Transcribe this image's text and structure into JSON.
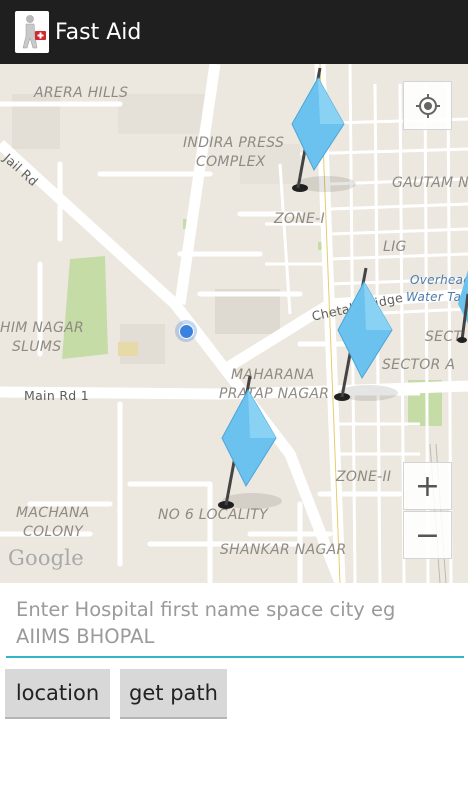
{
  "app": {
    "title": "Fast Aid",
    "icon": "first-aid-person-icon"
  },
  "map": {
    "labels": {
      "arera_hills": "ARERA HILLS",
      "indira_press_1": "INDIRA PRESS",
      "indira_press_2": "COMPLEX",
      "gautam_nagar": "GAUTAM NA",
      "jail_rd": "Jail Rd",
      "zone_1": "ZONE-I",
      "lig": "LIG",
      "overhead_1": "Overhead",
      "overhead_2": "Water Tank",
      "chetak_bridge": "Chetak Bridge",
      "sect": "SECT",
      "him_nagar_1": "HIM NAGAR",
      "him_nagar_2": "SLUMS",
      "sector_a": "SECTOR A",
      "maharana_1": "MAHARANA",
      "maharana_2": "PRATAP NAGAR",
      "main_rd": "Main Rd 1",
      "zone_2": "ZONE-II",
      "machana_1": "MACHANA",
      "machana_2": "COLONY",
      "no6": "NO 6 LOCALITY",
      "shankar_nagar": "SHANKAR NAGAR"
    },
    "google_logo": "Google",
    "controls": {
      "my_location_icon": "crosshair-icon",
      "zoom_in": "+",
      "zoom_out": "−"
    },
    "markers": [
      "hospital-flag-1",
      "hospital-flag-2",
      "hospital-flag-3",
      "hospital-flag-4"
    ],
    "colors": {
      "flag": "#6cc2ee",
      "location_dot": "#3b82e0",
      "park": "#c5dca6"
    }
  },
  "search": {
    "placeholder": "Enter Hospital first name space city eg AIIMS BHOPAL",
    "value": ""
  },
  "buttons": {
    "location": "location",
    "get_path": "get path"
  },
  "colors": {
    "actionbar": "#1f1f1f",
    "accent": "#33b5c7"
  }
}
